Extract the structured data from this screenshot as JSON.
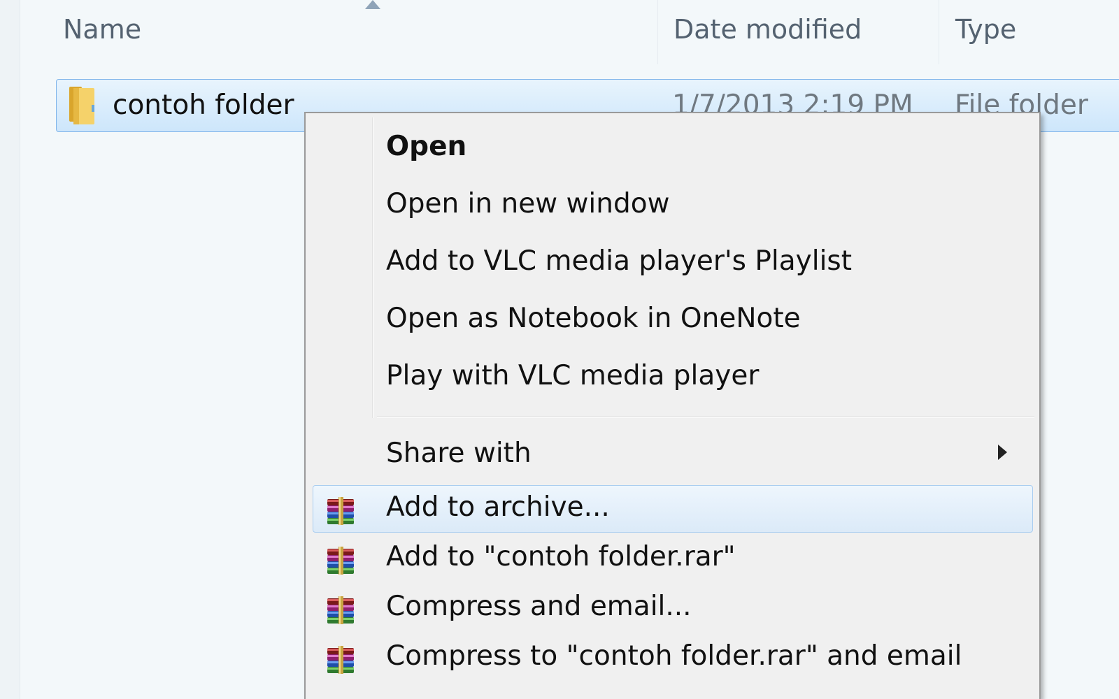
{
  "columns": {
    "name": "Name",
    "date_modified": "Date modified",
    "type": "Type"
  },
  "file_row": {
    "name": "contoh folder",
    "date": "1/7/2013 2:19 PM",
    "type": "File folder",
    "icon": "folder-icon"
  },
  "context_menu": {
    "items": [
      {
        "label": "Open",
        "default": true
      },
      {
        "label": "Open in new window"
      },
      {
        "label": "Add to VLC media player's Playlist"
      },
      {
        "label": "Open as Notebook in OneNote"
      },
      {
        "label": "Play with VLC media player"
      },
      {
        "label": "Share with",
        "submenu": true
      },
      {
        "label": "Add to archive...",
        "icon": "winrar-icon",
        "highlighted": true
      },
      {
        "label": "Add to \"contoh folder.rar\"",
        "icon": "winrar-icon"
      },
      {
        "label": "Compress and email...",
        "icon": "winrar-icon"
      },
      {
        "label": "Compress to \"contoh folder.rar\" and email",
        "icon": "winrar-icon"
      }
    ]
  },
  "colors": {
    "selection_fill": "#cde6fb",
    "selection_border": "#7eb4ea",
    "menu_bg": "#f0f0f0",
    "hover_border": "#a9cdf0"
  }
}
